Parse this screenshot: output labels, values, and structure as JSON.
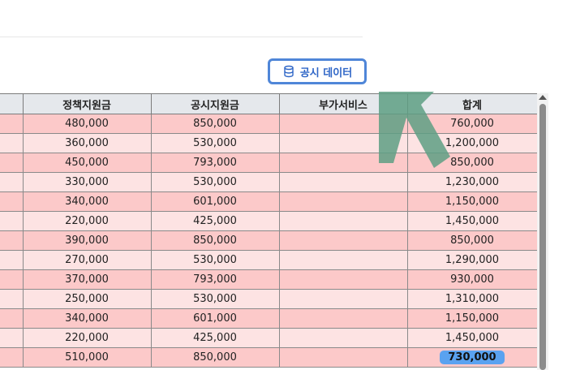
{
  "toolbar": {
    "public_data_button_label": "공시 데이터",
    "public_data_icon": "database-icon"
  },
  "table": {
    "headers": [
      "",
      "정책지원금",
      "공시지원금",
      "부가서비스",
      "합계"
    ],
    "rows": [
      [
        "",
        "480,000",
        "850,000",
        "",
        "760,000"
      ],
      [
        "",
        "360,000",
        "530,000",
        "",
        "1,200,000"
      ],
      [
        "",
        "450,000",
        "793,000",
        "",
        "850,000"
      ],
      [
        "",
        "330,000",
        "530,000",
        "",
        "1,230,000"
      ],
      [
        "",
        "340,000",
        "601,000",
        "",
        "1,150,000"
      ],
      [
        "",
        "220,000",
        "425,000",
        "",
        "1,450,000"
      ],
      [
        "",
        "390,000",
        "850,000",
        "",
        "850,000"
      ],
      [
        "",
        "270,000",
        "530,000",
        "",
        "1,290,000"
      ],
      [
        "",
        "370,000",
        "793,000",
        "",
        "930,000"
      ],
      [
        "",
        "250,000",
        "530,000",
        "",
        "1,310,000"
      ],
      [
        "",
        "340,000",
        "601,000",
        "",
        "1,150,000"
      ],
      [
        "",
        "220,000",
        "425,000",
        "",
        "1,450,000"
      ],
      [
        "",
        "510,000",
        "850,000",
        "",
        "730,000"
      ]
    ],
    "highlighted_cell": "730,000"
  },
  "colors": {
    "accent": "#4f86d8",
    "row_odd": "#fcc9c9",
    "row_even": "#fde3e3",
    "highlight": "#5aa2f0",
    "overlay_arrow": "#5e9f84"
  }
}
